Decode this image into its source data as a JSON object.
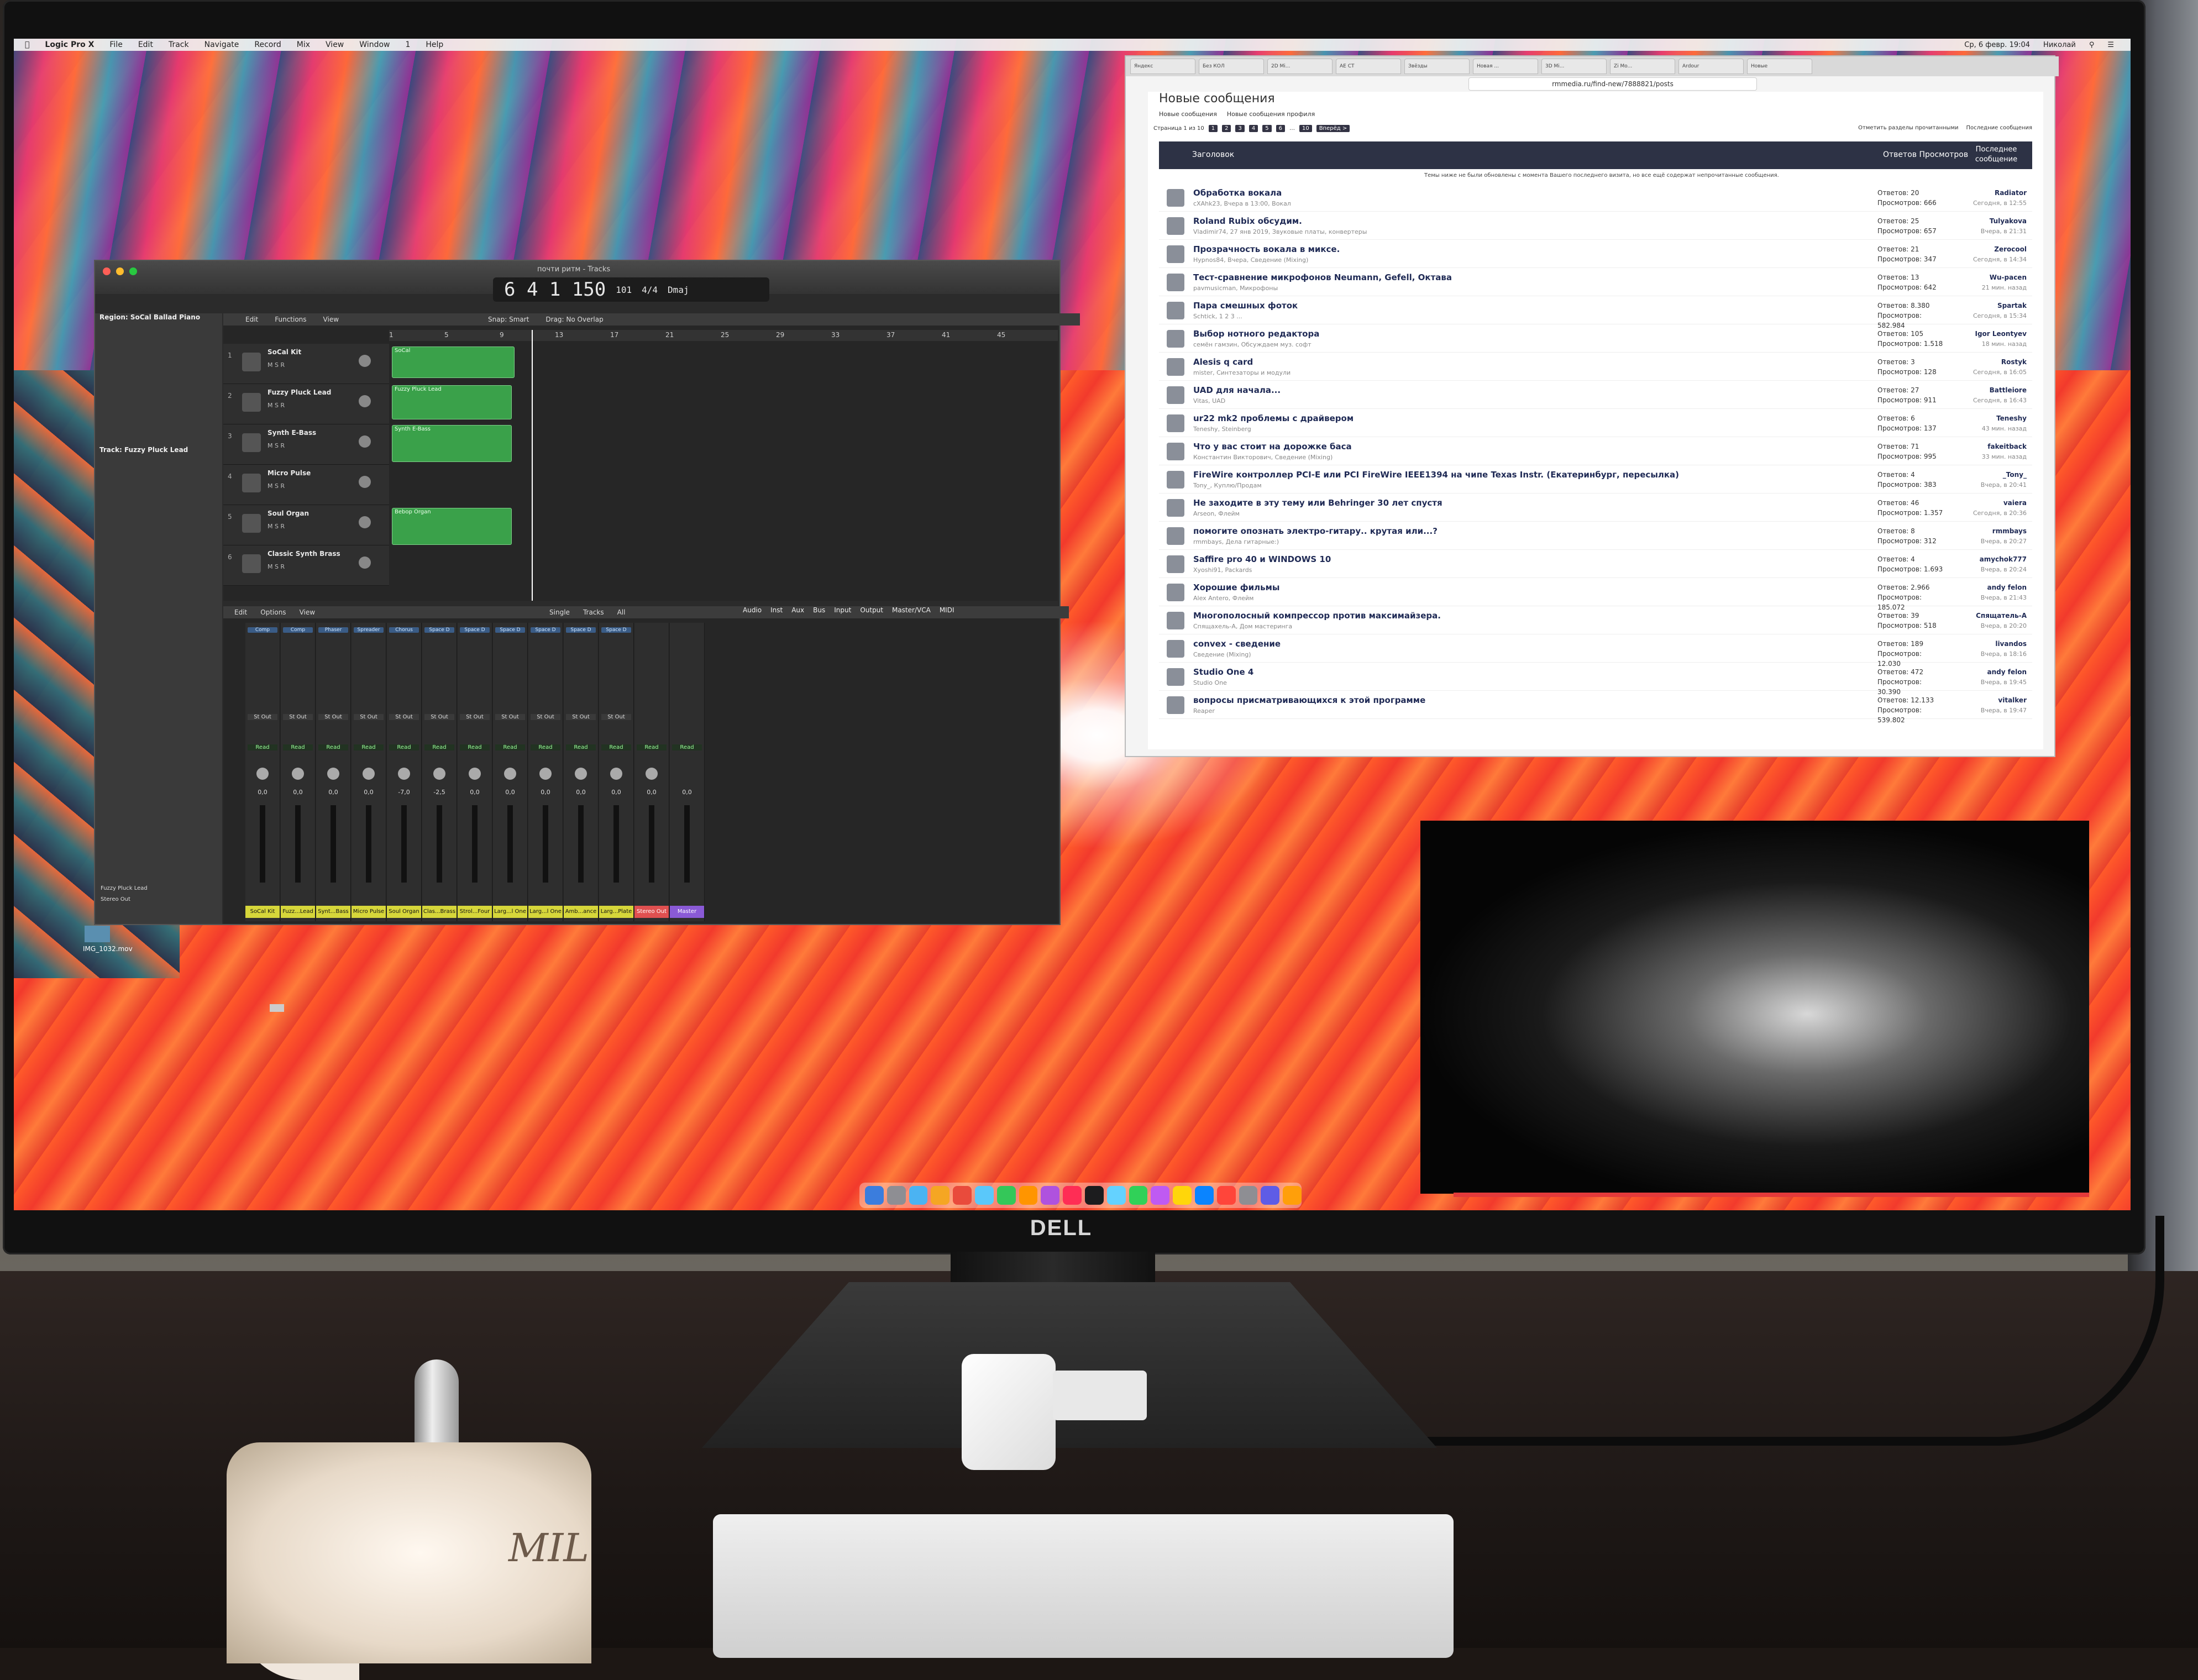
{
  "menubar": {
    "app": "Logic Pro X",
    "items": [
      "File",
      "Edit",
      "Track",
      "Navigate",
      "Record",
      "Mix",
      "View",
      "Window",
      "1",
      "Help"
    ],
    "clock": "Ср, 6 февр. 19:04",
    "user": "Николай"
  },
  "logic": {
    "window_title": "почти ритм - Tracks",
    "transport_display": "6 4 1 150",
    "tempo": "101",
    "time_sig": "4/4",
    "key": "Dmaj",
    "inspector_region": "Region: SoCal Ballad Piano",
    "inspector_track": "Track: Fuzzy Pluck Lead",
    "toolbar": [
      "Edit",
      "Functions",
      "View",
      "Snap: Smart",
      "Drag: No Overlap"
    ],
    "ruler": [
      "1",
      "5",
      "9",
      "13",
      "17",
      "21",
      "25",
      "29",
      "33",
      "37",
      "41",
      "45"
    ],
    "tracks": [
      {
        "num": "1",
        "name": "SoCal Kit"
      },
      {
        "num": "2",
        "name": "Fuzzy Pluck Lead"
      },
      {
        "num": "3",
        "name": "Synth E-Bass"
      },
      {
        "num": "4",
        "name": "Micro Pulse"
      },
      {
        "num": "5",
        "name": "Soul Organ"
      },
      {
        "num": "6",
        "name": "Classic Synth Brass"
      }
    ],
    "msr": "M S R",
    "regions": {
      "r1": "SoCal",
      "r2": "Fuzzy Pluck Lead",
      "r3": "Synth E-Bass",
      "r4": "Bebop Organ"
    },
    "mixer_toolbar": [
      "Edit",
      "Options",
      "View",
      "Single",
      "Tracks",
      "All"
    ],
    "mixer_filter": [
      "Audio",
      "Inst",
      "Aux",
      "Bus",
      "Input",
      "Output",
      "Master/VCA",
      "MIDI"
    ],
    "strips": [
      {
        "name": "SoCal Kit",
        "db": "0,0",
        "fx": "Comp"
      },
      {
        "name": "Fuzz...Lead",
        "db": "0,0",
        "fx": "Comp"
      },
      {
        "name": "Synt...Bass",
        "db": "0,0",
        "fx": "Phaser"
      },
      {
        "name": "Micro Pulse",
        "db": "0,0",
        "fx": "Spreader"
      },
      {
        "name": "Soul Organ",
        "db": "-7,0",
        "fx": "Chorus"
      },
      {
        "name": "Clas...Brass",
        "db": "-2,5",
        "fx": "Space D"
      },
      {
        "name": "Strol...Four",
        "db": "0,0",
        "fx": "Space D"
      },
      {
        "name": "Larg...l One",
        "db": "0,0",
        "fx": "Space D"
      },
      {
        "name": "Larg...l One",
        "db": "0,0",
        "fx": "Space D"
      },
      {
        "name": "Amb...ance",
        "db": "0,0",
        "fx": "Space D"
      },
      {
        "name": "Larg...Plate",
        "db": "0,0",
        "fx": "Space D"
      },
      {
        "name": "Stereo Out",
        "db": "0,0",
        "fx": ""
      },
      {
        "name": "Master",
        "db": "0,0",
        "fx": ""
      }
    ],
    "output_label": "St Out",
    "read_label": "Read",
    "left_strip_name": "Fuzzy Pluck Lead",
    "left_strip_out": "Stereo Out"
  },
  "browser": {
    "url": "rmmedia.ru/find-new/7888821/posts",
    "tabs": [
      "Яндекс",
      "Без КОЛ",
      "2D Mi...",
      "AE CT",
      "Звёзды",
      "Новая ...",
      "3D Mi...",
      "Zi Mo...",
      "Ardour",
      "Новые"
    ],
    "title": "Новые сообщения",
    "subnav": [
      "Новые сообщения",
      "Новые сообщения профиля"
    ],
    "pages_label": "Страница 1 из 10",
    "pages": [
      "1",
      "2",
      "3",
      "4",
      "5",
      "6",
      "…",
      "10",
      "Вперёд >"
    ],
    "actions": [
      "Отметить разделы прочитанными",
      "Последние сообщения"
    ],
    "head_title": "Заголовок",
    "head_counts": "Ответов Просмотров",
    "head_last": "Последнее сообщение",
    "note": "Темы ниже не были обновлены с момента Вашего последнего визита, но все ещё содержат непрочитанные сообщения.",
    "rows": [
      {
        "title": "Обработка вокала",
        "sub": "cXAhk23, Вчера в 13:00, Вокал",
        "replies": "20",
        "views": "666",
        "last_user": "Radiator",
        "last_time": "Сегодня, в 12:55"
      },
      {
        "title": "Roland Rubix обсудим.",
        "sub": "Vladimir74, 27 янв 2019, Звуковые платы, конвертеры",
        "replies": "25",
        "views": "657",
        "last_user": "Tulyakova",
        "last_time": "Вчера, в 21:31"
      },
      {
        "title": "Прозрачность вокала в миксе.",
        "sub": "Hypnos84, Вчера, Сведение (Mixing)",
        "replies": "21",
        "views": "347",
        "last_user": "Zerocool",
        "last_time": "Сегодня, в 14:34"
      },
      {
        "title": "Тест-сравнение микрофонов Neumann, Gefell, Октава",
        "sub": "pavmusicman, Микрофоны",
        "replies": "13",
        "views": "642",
        "last_user": "Wu-pacen",
        "last_time": "21 мин. назад"
      },
      {
        "title": "Пара смешных фоток",
        "sub": "Schtick, 1 2 3 ...",
        "replies": "8.380",
        "views": "582.984",
        "last_user": "Spartak",
        "last_time": "Сегодня, в 15:34"
      },
      {
        "title": "Выбор нотного редактора",
        "sub": "семён гамзин, Обсуждаем муз. софт",
        "replies": "105",
        "views": "1.518",
        "last_user": "Igor Leontyev",
        "last_time": "18 мин. назад"
      },
      {
        "title": "Alesis q card",
        "sub": "mister, Синтезаторы и модули",
        "replies": "3",
        "views": "128",
        "last_user": "Rostyk",
        "last_time": "Сегодня, в 16:05"
      },
      {
        "title": "UAD для начала...",
        "sub": "Vitas, UAD",
        "replies": "27",
        "views": "911",
        "last_user": "Battleiore",
        "last_time": "Сегодня, в 16:43"
      },
      {
        "title": "ur22 mk2 проблемы с драйвером",
        "sub": "Teneshy, Steinberg",
        "replies": "6",
        "views": "137",
        "last_user": "Teneshy",
        "last_time": "43 мин. назад"
      },
      {
        "title": "Что у вас стоит на дорожке баса",
        "sub": "Константин Викторович, Сведение (Mixing)",
        "replies": "71",
        "views": "995",
        "last_user": "fakeitback",
        "last_time": "33 мин. назад"
      },
      {
        "title": "FireWire контроллер PCI-E или PCI FireWire IEEE1394 на чипе Texas Instr. (Екатеринбург, пересылка)",
        "sub": "Tony_, Куплю/Продам",
        "replies": "4",
        "views": "383",
        "last_user": "_Tony_",
        "last_time": "Вчера, в 20:41"
      },
      {
        "title": "Не заходите в эту тему или Behringer 30 лет спустя",
        "sub": "Arseon, Флейм",
        "replies": "46",
        "views": "1.357",
        "last_user": "vaiera",
        "last_time": "Сегодня, в 20:36"
      },
      {
        "title": "помогите опознать электро-гитару.. крутая или...?",
        "sub": "rmmbays, Дела гитарные:)",
        "replies": "8",
        "views": "312",
        "last_user": "rmmbays",
        "last_time": "Вчера, в 20:27"
      },
      {
        "title": "Saffire pro 40 и WINDOWS 10",
        "sub": "Xyoshi91, Packards",
        "replies": "4",
        "views": "1.693",
        "last_user": "amychok777",
        "last_time": "Вчера, в 20:24"
      },
      {
        "title": "Хорошие фильмы",
        "sub": "Alex Antero, Флейм",
        "replies": "2.966",
        "views": "185.072",
        "last_user": "andy felon",
        "last_time": "Вчера, в 21:43"
      },
      {
        "title": "Многополосный компрессор против максимайзера.",
        "sub": "Спящахель-А, Дом мастеринга",
        "replies": "39",
        "views": "518",
        "last_user": "Спящатель-А",
        "last_time": "Вчера, в 20:20"
      },
      {
        "title": "conveх - сведение",
        "sub": "Сведение (Mixing)",
        "replies": "189",
        "views": "12.030",
        "last_user": "livandos",
        "last_time": "Вчера, в 18:16"
      },
      {
        "title": "Studio One 4",
        "sub": "Studio One",
        "replies": "472",
        "views": "30.390",
        "last_user": "andy felon",
        "last_time": "Вчера, в 19:45"
      },
      {
        "title": "вопросы присматривающихся к этой программе",
        "sub": "Reaper",
        "replies": "12.133",
        "views": "539.802",
        "last_user": "vitalker",
        "last_time": "Вчера, в 19:47"
      }
    ],
    "replies_label": "Ответов:",
    "views_label": "Просмотров:"
  },
  "desktop": {
    "file": "IMG_1032.mov"
  },
  "monitor": {
    "brand": "DELL"
  },
  "mug": {
    "text": "MIL"
  }
}
